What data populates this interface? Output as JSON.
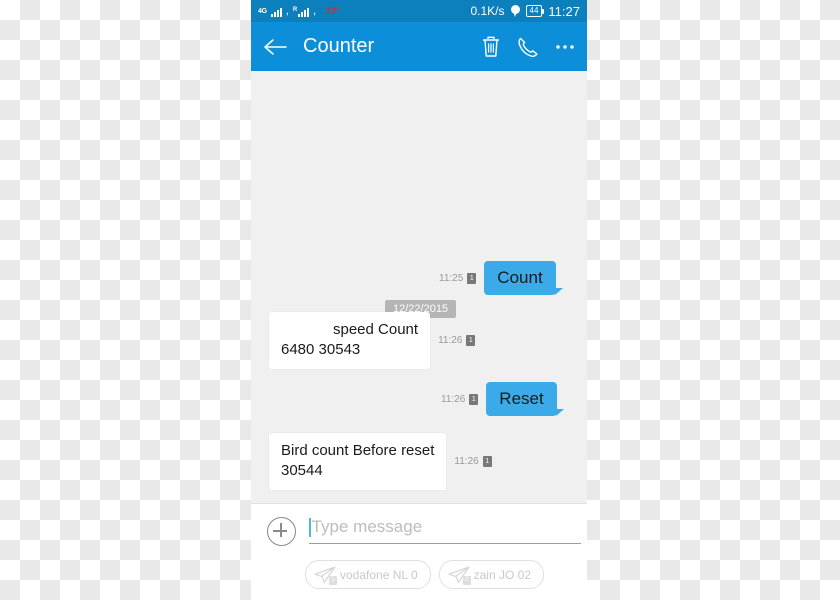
{
  "statusbar": {
    "network_type": "4G",
    "roaming_label": "R",
    "temperature": "12°",
    "data_speed": "0.1K/s",
    "location_icon": "location-pin-icon",
    "battery_level": "44",
    "time": "11:27"
  },
  "appbar": {
    "back_icon": "back-arrow-icon",
    "title": "Counter",
    "delete_icon": "trash-icon",
    "call_icon": "phone-icon",
    "overflow_icon": "more-options-icon"
  },
  "conversation": {
    "date_separator": "12/22/2015",
    "messages": [
      {
        "direction": "outgoing",
        "text": "Count",
        "time": "11:25",
        "sim": "1"
      },
      {
        "direction": "incoming",
        "line1": "speed  Count",
        "line2": "6480 30543",
        "time": "11:26",
        "sim": "1"
      },
      {
        "direction": "outgoing",
        "text": "Reset",
        "time": "11:26",
        "sim": "1"
      },
      {
        "direction": "incoming",
        "line1": "Bird count  Before reset",
        "line2": "30544",
        "time": "11:26",
        "sim": "1"
      }
    ]
  },
  "composer": {
    "attach_icon": "plus-circle-icon",
    "input_placeholder": "Type message",
    "input_value": "",
    "send_buttons": [
      {
        "label": "vodafone NL 0",
        "sim": "1",
        "icon": "send-plane-icon"
      },
      {
        "label": "zain JO 02",
        "sim": "2",
        "icon": "send-plane-icon"
      }
    ]
  },
  "colors": {
    "statusbar_blue": "#0c7fbd",
    "appbar_blue": "#0d8ed8",
    "bubble_blue": "#3aaae8",
    "chat_background": "#f0f0f0",
    "temperature_red": "#e8252a",
    "accent_cyan": "#4fb4e8"
  }
}
